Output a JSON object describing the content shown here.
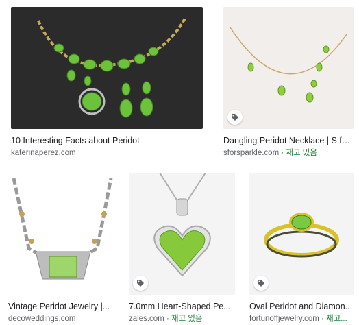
{
  "results": [
    {
      "title": "10 Interesting Facts about Peridot",
      "source": "katerinaperez.com",
      "stock": ""
    },
    {
      "title": "Dangling Peridot Necklace | S fo...",
      "source": "sforsparkle.com",
      "stock": " · 재고 있음"
    },
    {
      "title": "Vintage Peridot Jewelry |...",
      "source": "decoweddings.com",
      "stock": ""
    },
    {
      "title": "7.0mm Heart-Shaped Pe...",
      "source": "zales.com",
      "stock": " · 재고 있음"
    },
    {
      "title": "Oval Peridot and Diamon...",
      "source": "fortunoffjewelry.com",
      "stock": " · 재고..."
    }
  ],
  "icons": {
    "product_tag": "tag-icon"
  },
  "colors": {
    "peridot": "#7ac943",
    "link_stock": "#188038",
    "source": "#5f6368"
  }
}
